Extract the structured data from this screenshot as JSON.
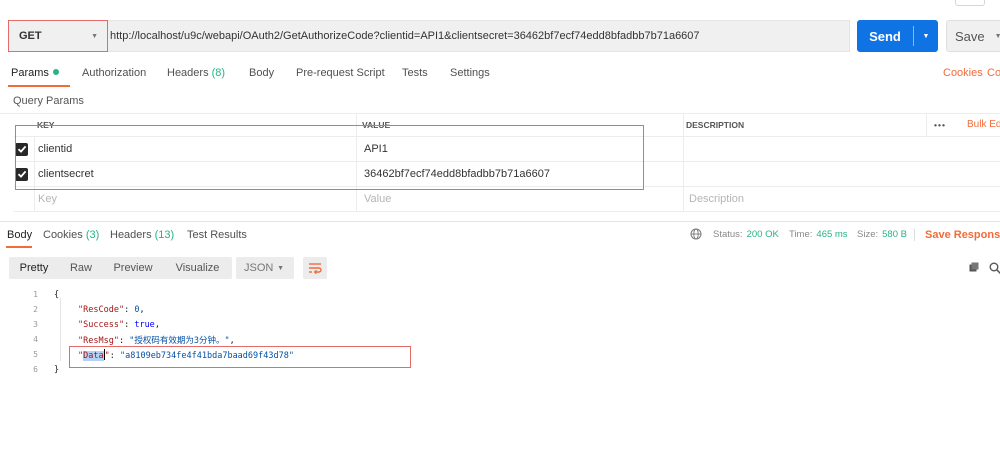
{
  "request": {
    "method": "GET",
    "url": "http://localhost/u9c/webapi/OAuth2/GetAuthorizeCode?clientid=API1&clientsecret=36462bf7ecf74edd8bfadbb7b71a6607",
    "send_label": "Send",
    "save_label": "Save"
  },
  "request_tabs": [
    {
      "label": "Params",
      "count": ""
    },
    {
      "label": "Authorization",
      "count": ""
    },
    {
      "label": "Headers",
      "count": "(8)"
    },
    {
      "label": "Body",
      "count": ""
    },
    {
      "label": "Pre-request Script",
      "count": ""
    },
    {
      "label": "Tests",
      "count": ""
    },
    {
      "label": "Settings",
      "count": ""
    }
  ],
  "request_tab_links": {
    "cookies": "Cookies",
    "code": "Co"
  },
  "query_params": {
    "title": "Query Params",
    "headers": {
      "key": "KEY",
      "value": "VALUE",
      "description": "DESCRIPTION",
      "more": "•••",
      "bulk_edit": "Bulk Ed"
    },
    "rows": [
      {
        "key": "clientid",
        "value": "API1",
        "description": "",
        "checked": true
      },
      {
        "key": "clientsecret",
        "value": "36462bf7ecf74edd8bfadbb7b71a6607",
        "description": "",
        "checked": true
      }
    ],
    "placeholder": {
      "key": "Key",
      "value": "Value",
      "description": "Description"
    }
  },
  "response_tabs": [
    {
      "label": "Body",
      "count": ""
    },
    {
      "label": "Cookies",
      "count": "(3)"
    },
    {
      "label": "Headers",
      "count": "(13)"
    },
    {
      "label": "Test Results",
      "count": ""
    }
  ],
  "response_status": {
    "status_label": "Status:",
    "status_value": "200 OK",
    "time_label": "Time:",
    "time_value": "465 ms",
    "size_label": "Size:",
    "size_value": "580 B",
    "save_response": "Save Response"
  },
  "viewer": {
    "modes": [
      "Pretty",
      "Raw",
      "Preview",
      "Visualize"
    ],
    "format": "JSON"
  },
  "response_body": {
    "line_numbers": [
      "1",
      "2",
      "3",
      "4",
      "5",
      "6"
    ],
    "open_brace": "{",
    "close_brace": "}",
    "fields": [
      {
        "key": "ResCode",
        "value": "0",
        "value_type": "number"
      },
      {
        "key": "Success",
        "value": "true",
        "value_type": "literal"
      },
      {
        "key": "ResMsg",
        "value": "\"授权码有效期为3分钟。\"",
        "value_type": "string"
      },
      {
        "key": "Data",
        "value": "\"a8109eb734fe4f41bda7baad69f43d78\"",
        "value_type": "string"
      }
    ]
  },
  "colors": {
    "accent": "#f26b3a",
    "send": "#0f73e4",
    "success": "#26b47f",
    "highlight_box": "#e56a6a"
  },
  "icons": [
    "chevron-down-icon",
    "checkbox-checked-icon",
    "globe-icon",
    "wrap-lines-icon",
    "copy-icon",
    "search-icon"
  ]
}
